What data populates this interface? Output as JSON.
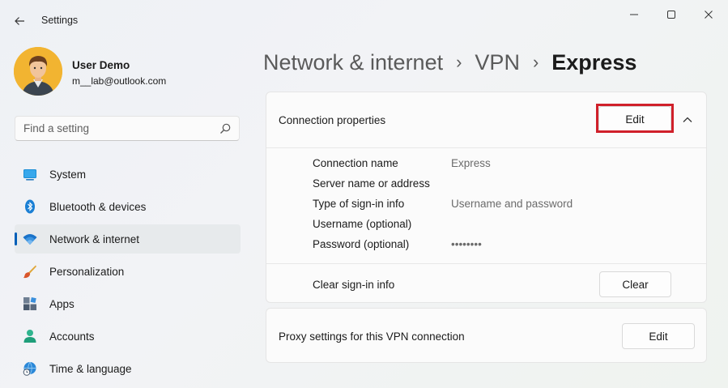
{
  "window": {
    "title": "Settings"
  },
  "user": {
    "name": "User Demo",
    "email": "m__lab@outlook.com"
  },
  "search": {
    "placeholder": "Find a setting"
  },
  "sidebar": {
    "items": [
      {
        "label": "System",
        "icon": "system-icon",
        "active": false
      },
      {
        "label": "Bluetooth & devices",
        "icon": "bluetooth-icon",
        "active": false
      },
      {
        "label": "Network & internet",
        "icon": "wifi-icon",
        "active": true
      },
      {
        "label": "Personalization",
        "icon": "brush-icon",
        "active": false
      },
      {
        "label": "Apps",
        "icon": "apps-icon",
        "active": false
      },
      {
        "label": "Accounts",
        "icon": "accounts-icon",
        "active": false
      },
      {
        "label": "Time & language",
        "icon": "globe-clock-icon",
        "active": false
      }
    ]
  },
  "breadcrumb": {
    "items": [
      "Network & internet",
      "VPN"
    ],
    "separator": "›",
    "current": "Express"
  },
  "connection_properties": {
    "title": "Connection properties",
    "edit_label": "Edit",
    "properties": [
      {
        "label": "Connection name",
        "value": "Express"
      },
      {
        "label": "Server name or address",
        "value": ""
      },
      {
        "label": "Type of sign-in info",
        "value": "Username and password"
      },
      {
        "label": "Username (optional)",
        "value": ""
      },
      {
        "label": "Password (optional)",
        "value": "••••••••"
      }
    ],
    "clear_label": "Clear sign-in info",
    "clear_button": "Clear"
  },
  "proxy": {
    "label": "Proxy settings for this VPN connection",
    "edit_label": "Edit"
  },
  "colors": {
    "accent": "#005fb8",
    "highlight": "#d0202a"
  }
}
